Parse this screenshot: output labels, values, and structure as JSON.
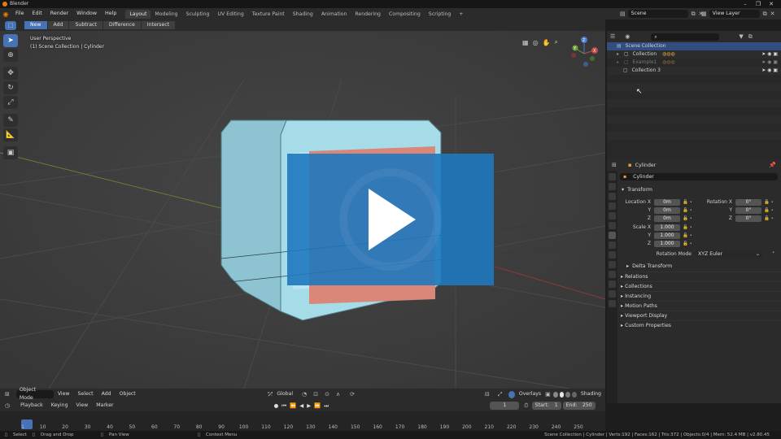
{
  "window": {
    "title": "Blender"
  },
  "menu": [
    "File",
    "Edit",
    "Render",
    "Window",
    "Help"
  ],
  "workspaces": [
    "Layout",
    "Modeling",
    "Sculpting",
    "UV Editing",
    "Texture Paint",
    "Shading",
    "Animation",
    "Rendering",
    "Compositing",
    "Scripting"
  ],
  "workspace_add": "+",
  "scene": {
    "name": "Scene",
    "view_layer": "View Layer"
  },
  "tool_header": {
    "modes": [
      "New",
      "Add",
      "Subtract",
      "Difference",
      "Intersect"
    ]
  },
  "viewport": {
    "perspective": "User Perspective",
    "context": "(1) Scene Collection | Cylinder",
    "header": {
      "mode": "Object Mode",
      "menus": [
        "View",
        "Select",
        "Add",
        "Object"
      ],
      "orientation": "Global",
      "overlays": "Overlays",
      "shading": "Shading"
    },
    "gizmo": {
      "x": "X",
      "y": "Y",
      "z": "Z"
    }
  },
  "outliner": {
    "root": "Scene Collection",
    "items": [
      {
        "name": "Collection",
        "state": "visible"
      },
      {
        "name": "Example1",
        "state": "excluded"
      },
      {
        "name": "Collection 3",
        "state": "visible"
      }
    ]
  },
  "properties": {
    "object_name": "Cylinder",
    "data_name": "Cylinder",
    "transform_label": "Transform",
    "location": {
      "label": "Location X",
      "y": "Y",
      "z": "Z",
      "values": [
        "0m",
        "0m",
        "0m"
      ]
    },
    "rotation": {
      "label": "Rotation X",
      "y": "Y",
      "z": "Z",
      "values": [
        "0°",
        "0°",
        "0°"
      ]
    },
    "scale": {
      "label": "Scale X",
      "y": "Y",
      "z": "Z",
      "values": [
        "1.000",
        "1.000",
        "1.000"
      ]
    },
    "rotation_mode_label": "Rotation Mode",
    "rotation_mode": "XYZ Euler",
    "delta_transform": "Delta Transform",
    "panels": [
      "Relations",
      "Collections",
      "Instancing",
      "Motion Paths",
      "Viewport Display",
      "Custom Properties"
    ]
  },
  "timeline": {
    "menus": [
      "Playback",
      "Keying",
      "View",
      "Marker"
    ],
    "current_frame": "1",
    "start_label": "Start:",
    "start": "1",
    "end_label": "End:",
    "end": "250",
    "ruler": [
      "1",
      "10",
      "20",
      "30",
      "40",
      "50",
      "60",
      "70",
      "80",
      "90",
      "100",
      "110",
      "120",
      "130",
      "140",
      "150",
      "160",
      "170",
      "180",
      "190",
      "200",
      "210",
      "220",
      "230",
      "240",
      "250"
    ]
  },
  "status": {
    "left": [
      "Select",
      "Drag and Drop",
      "Pan View",
      "Context Menu"
    ],
    "right": "Scene Collection | Cylinder | Verts:192 | Faces:162 | Tris:372 | Objects:0/4 | Mem: 52.4 MB | v2.80.45"
  },
  "colors": {
    "accent": "#4772b3",
    "overlay": "#1e78be",
    "object_fill": "#a6dbe8",
    "inner_face": "#d98779"
  }
}
